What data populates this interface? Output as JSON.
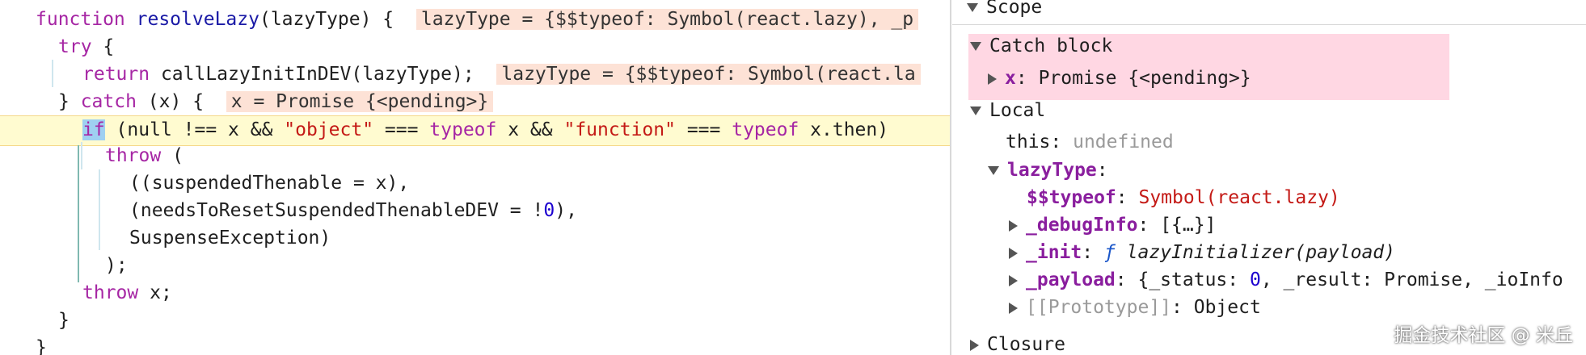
{
  "code": {
    "l1_kw": "function",
    "l1_name": "resolveLazy",
    "l1_rest": "(lazyType) {",
    "l1_inline": "lazyType = {$$typeof: Symbol(react.lazy), _p",
    "l2_kw": "try",
    "l2_rest": " {",
    "l3_kw": "return",
    "l3_rest": " callLazyInitInDEV(lazyType);",
    "l3_inline": "lazyType = {$$typeof: Symbol(react.la",
    "l4_pre": "} ",
    "l4_kw": "catch",
    "l4_rest": " (x) {",
    "l4_inline": "x = Promise {<pending>}",
    "l5_kw": "if",
    "l5_a": " (null !== x && ",
    "l5_s1": "\"object\"",
    "l5_b": " === ",
    "l5_t1": "typeof",
    "l5_c": " x && ",
    "l5_s2": "\"function\"",
    "l5_d": " === ",
    "l5_t2": "typeof",
    "l5_e": " x.then)",
    "l6_kw": "throw",
    "l6_rest": " (",
    "l7": "((suspendedThenable = x),",
    "l8_a": "(needsToResetSuspendedThenableDEV = !",
    "l8_num": "0",
    "l8_b": "),",
    "l9": "SuspenseException)",
    "l10": ");",
    "l11_kw": "throw",
    "l11_rest": " x;",
    "l12": "}",
    "l13": "}"
  },
  "scope": {
    "header": "Scope",
    "catch_block": "Catch block",
    "catch_x_key": "x",
    "catch_x_val": "Promise {<pending>}",
    "local": "Local",
    "this_key": "this",
    "this_val": "undefined",
    "lazytype_key": "lazyType",
    "typeof_key": "$$typeof",
    "typeof_val": "Symbol(react.lazy)",
    "debuginfo_key": "_debugInfo",
    "debuginfo_val": "[{…}]",
    "init_key": "_init",
    "init_f": "ƒ",
    "init_val": "lazyInitializer(payload)",
    "payload_key": "_payload",
    "payload_val_a": "{_status: ",
    "payload_num": "0",
    "payload_val_b": ", _result: Promise, _ioInfo",
    "proto_key": "[[Prototype]]",
    "proto_val": "Object",
    "closure": "Closure"
  },
  "watermark": "掘金技术社区 @ 米丘"
}
